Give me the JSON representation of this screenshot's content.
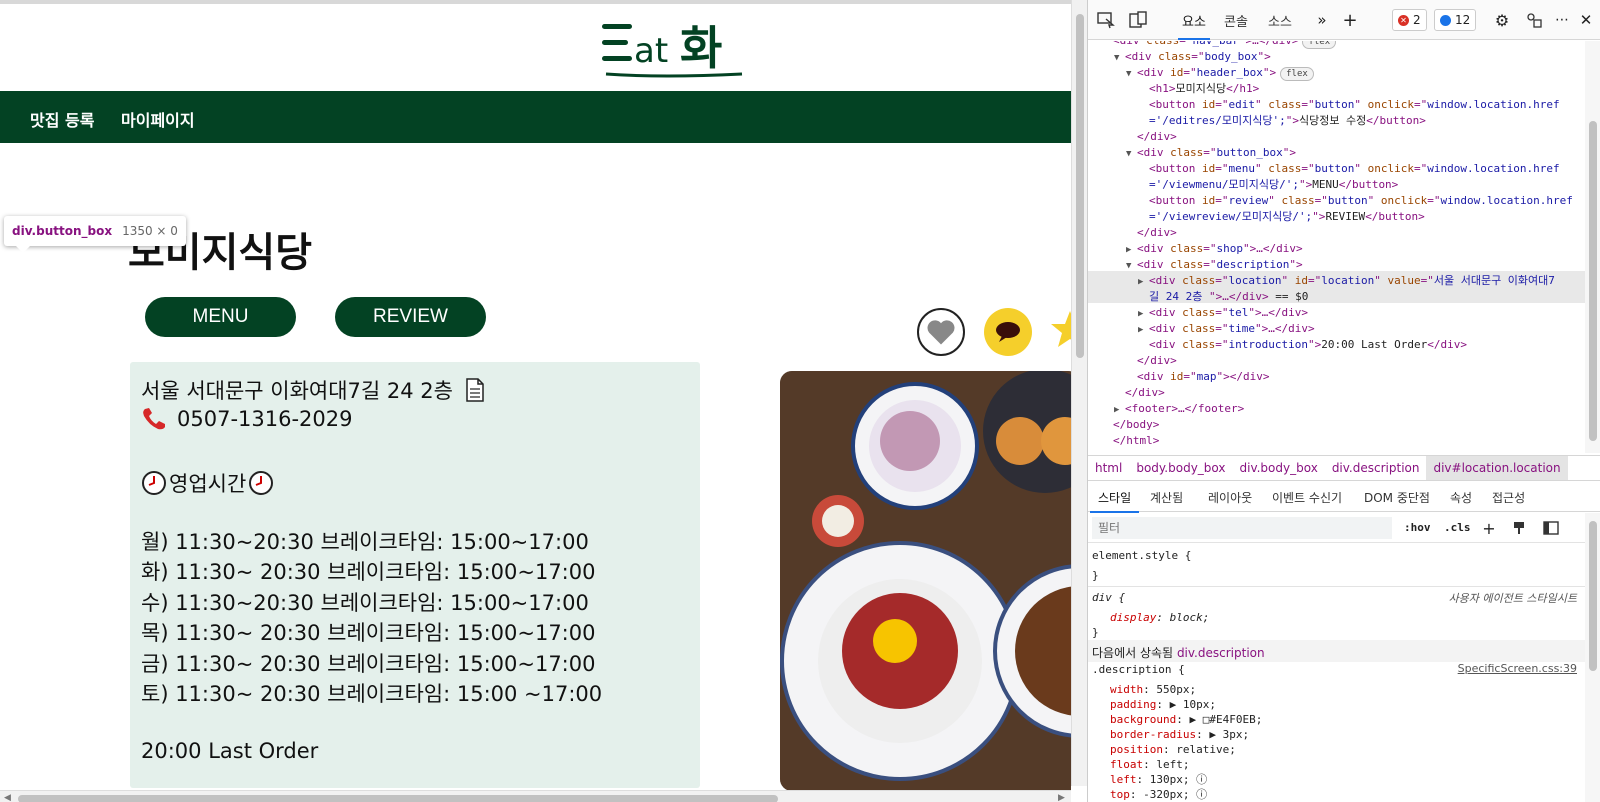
{
  "page": {
    "logo_text": "Eat화",
    "nav": [
      "맛집 등록",
      "마이페이지"
    ],
    "tooltip": {
      "tag": "div.button_box",
      "size": "1350 × 0"
    },
    "shop_title": "모미지식당",
    "buttons": {
      "menu": "MENU",
      "review": "REVIEW"
    },
    "description": {
      "location": "서울 서대문구 이화여대7길 24 2층",
      "tel": "0507-1316-2029",
      "hours_title": "영업시간",
      "hours": [
        "월) 11:30~20:30 브레이크타임: 15:00~17:00",
        "화) 11:30~ 20:30 브레이크타임: 15:00~17:00",
        "수) 11:30~20:30 브레이크타임: 15:00~17:00",
        "목) 11:30~ 20:30 브레이크타임: 15:00~17:00",
        "금) 11:30~ 20:30 브레이크타임: 15:00~17:00",
        "토) 11:30~ 20:30 브레이크타임: 15:00 ~17:00"
      ],
      "last_order": "20:00 Last Order"
    },
    "colors": {
      "brand_green": "#034223",
      "desc_bg": "#E4F0EB",
      "chat_yellow": "#f5cf2b"
    }
  },
  "devtools": {
    "tabs": [
      "요소",
      "콘솔",
      "소스"
    ],
    "errors": "2",
    "infos": "12",
    "dom": [
      {
        "indent": 0,
        "tri": "",
        "html": [
          [
            "tag",
            "<div "
          ],
          [
            "attr",
            "class"
          ],
          [
            "tag",
            "=\""
          ],
          [
            "val",
            "nav_bar"
          ],
          [
            "tag",
            "\">…</div>"
          ]
        ],
        "pill": "flex"
      },
      {
        "indent": 1,
        "tri": "▼",
        "html": [
          [
            "tag",
            "<div "
          ],
          [
            "attr",
            "class"
          ],
          [
            "tag",
            "=\""
          ],
          [
            "val",
            "body_box"
          ],
          [
            "tag",
            "\">"
          ]
        ]
      },
      {
        "indent": 2,
        "tri": "▼",
        "html": [
          [
            "tag",
            "<div "
          ],
          [
            "attr",
            "id"
          ],
          [
            "tag",
            "=\""
          ],
          [
            "val",
            "header_box"
          ],
          [
            "tag",
            "\">"
          ]
        ],
        "pill": "flex"
      },
      {
        "indent": 3,
        "tri": "",
        "html": [
          [
            "tag",
            "<h1>"
          ],
          [
            "txt",
            "모미지식당"
          ],
          [
            "tag",
            "</h1>"
          ]
        ]
      },
      {
        "indent": 3,
        "tri": "",
        "html": [
          [
            "tag",
            "<button "
          ],
          [
            "attr",
            "id"
          ],
          [
            "tag",
            "=\""
          ],
          [
            "val",
            "edit"
          ],
          [
            "tag",
            "\" "
          ],
          [
            "attr",
            "class"
          ],
          [
            "tag",
            "=\""
          ],
          [
            "val",
            "button"
          ],
          [
            "tag",
            "\" "
          ],
          [
            "attr",
            "onclick"
          ],
          [
            "tag",
            "=\""
          ],
          [
            "val",
            "window.location.href"
          ]
        ]
      },
      {
        "indent": 3,
        "tri": "",
        "html": [
          [
            "val",
            "='/editres/모미지식당';"
          ],
          [
            "tag",
            "\">"
          ],
          [
            "txt",
            "식당정보 수정"
          ],
          [
            "tag",
            "</button>"
          ]
        ]
      },
      {
        "indent": 2,
        "tri": "",
        "html": [
          [
            "tag",
            "</div>"
          ]
        ]
      },
      {
        "indent": 2,
        "tri": "▼",
        "html": [
          [
            "tag",
            "<div "
          ],
          [
            "attr",
            "class"
          ],
          [
            "tag",
            "=\""
          ],
          [
            "val",
            "button_box"
          ],
          [
            "tag",
            "\">"
          ]
        ]
      },
      {
        "indent": 3,
        "tri": "",
        "html": [
          [
            "tag",
            "<button "
          ],
          [
            "attr",
            "id"
          ],
          [
            "tag",
            "=\""
          ],
          [
            "val",
            "menu"
          ],
          [
            "tag",
            "\" "
          ],
          [
            "attr",
            "class"
          ],
          [
            "tag",
            "=\""
          ],
          [
            "val",
            "button"
          ],
          [
            "tag",
            "\" "
          ],
          [
            "attr",
            "onclick"
          ],
          [
            "tag",
            "=\""
          ],
          [
            "val",
            "window.location.href"
          ]
        ]
      },
      {
        "indent": 3,
        "tri": "",
        "html": [
          [
            "val",
            "='/viewmenu/모미지식당/';"
          ],
          [
            "tag",
            "\">"
          ],
          [
            "txt",
            "MENU"
          ],
          [
            "tag",
            "</button>"
          ]
        ]
      },
      {
        "indent": 3,
        "tri": "",
        "html": [
          [
            "tag",
            "<button "
          ],
          [
            "attr",
            "id"
          ],
          [
            "tag",
            "=\""
          ],
          [
            "val",
            "review"
          ],
          [
            "tag",
            "\" "
          ],
          [
            "attr",
            "class"
          ],
          [
            "tag",
            "=\""
          ],
          [
            "val",
            "button"
          ],
          [
            "tag",
            "\" "
          ],
          [
            "attr",
            "onclick"
          ],
          [
            "tag",
            "=\""
          ],
          [
            "val",
            "window.location.href"
          ]
        ]
      },
      {
        "indent": 3,
        "tri": "",
        "html": [
          [
            "val",
            "='/viewreview/모미지식당/';"
          ],
          [
            "tag",
            "\">"
          ],
          [
            "txt",
            "REVIEW"
          ],
          [
            "tag",
            "</button>"
          ]
        ]
      },
      {
        "indent": 2,
        "tri": "",
        "html": [
          [
            "tag",
            "</div>"
          ]
        ]
      },
      {
        "indent": 2,
        "tri": "▶",
        "html": [
          [
            "tag",
            "<div "
          ],
          [
            "attr",
            "class"
          ],
          [
            "tag",
            "=\""
          ],
          [
            "val",
            "shop"
          ],
          [
            "tag",
            "\">…</div>"
          ]
        ]
      },
      {
        "indent": 2,
        "tri": "▼",
        "html": [
          [
            "tag",
            "<div "
          ],
          [
            "attr",
            "class"
          ],
          [
            "tag",
            "=\""
          ],
          [
            "val",
            "description"
          ],
          [
            "tag",
            "\">"
          ]
        ]
      },
      {
        "indent": 3,
        "tri": "▶",
        "html": [
          [
            "tag",
            "<div "
          ],
          [
            "attr",
            "class"
          ],
          [
            "tag",
            "=\""
          ],
          [
            "val",
            "location"
          ],
          [
            "tag",
            "\" "
          ],
          [
            "attr",
            "id"
          ],
          [
            "tag",
            "=\""
          ],
          [
            "val",
            "location"
          ],
          [
            "tag",
            "\" "
          ],
          [
            "attr",
            "value"
          ],
          [
            "tag",
            "=\""
          ],
          [
            "val",
            "서울 서대문구 이화여대7"
          ]
        ]
      },
      {
        "indent": 3,
        "tri": "",
        "html": [
          [
            "val",
            "길 24 2층 "
          ],
          [
            "tag",
            "\">…</div>"
          ],
          [
            "txt",
            " == $0"
          ]
        ]
      },
      {
        "indent": 3,
        "tri": "▶",
        "html": [
          [
            "tag",
            "<div "
          ],
          [
            "attr",
            "class"
          ],
          [
            "tag",
            "=\""
          ],
          [
            "val",
            "tel"
          ],
          [
            "tag",
            "\">…</div>"
          ]
        ]
      },
      {
        "indent": 3,
        "tri": "▶",
        "html": [
          [
            "tag",
            "<div "
          ],
          [
            "attr",
            "class"
          ],
          [
            "tag",
            "=\""
          ],
          [
            "val",
            "time"
          ],
          [
            "tag",
            "\">…</div>"
          ]
        ]
      },
      {
        "indent": 3,
        "tri": "",
        "html": [
          [
            "tag",
            "<div "
          ],
          [
            "attr",
            "class"
          ],
          [
            "tag",
            "=\""
          ],
          [
            "val",
            "introduction"
          ],
          [
            "tag",
            "\">"
          ],
          [
            "txt",
            "20:00 Last Order"
          ],
          [
            "tag",
            "</div>"
          ]
        ]
      },
      {
        "indent": 2,
        "tri": "",
        "html": [
          [
            "tag",
            "</div>"
          ]
        ]
      },
      {
        "indent": 2,
        "tri": "",
        "html": [
          [
            "tag",
            "<div "
          ],
          [
            "attr",
            "id"
          ],
          [
            "tag",
            "=\""
          ],
          [
            "val",
            "map"
          ],
          [
            "tag",
            "\"></div>"
          ]
        ]
      },
      {
        "indent": 1,
        "tri": "",
        "html": [
          [
            "tag",
            "</div>"
          ]
        ]
      },
      {
        "indent": 1,
        "tri": "▶",
        "html": [
          [
            "tag",
            "<footer>…</footer>"
          ]
        ]
      },
      {
        "indent": 0,
        "tri": "",
        "html": [
          [
            "tag",
            "</body>"
          ]
        ]
      },
      {
        "indent": 0,
        "tri": "",
        "html": [
          [
            "tag",
            "</html>"
          ]
        ]
      }
    ],
    "breadcrumbs": [
      "html",
      "body.body_box",
      "div.body_box",
      "div.description",
      "div#location.location"
    ],
    "subtabs": [
      "스타일",
      "계산됨",
      "레이아웃",
      "이벤트 수신기",
      "DOM 중단점",
      "속성",
      "접근성"
    ],
    "filter_placeholder": "필터",
    "hov": ":hov",
    "cls": ".cls",
    "styles": {
      "element_style": "element.style {",
      "close": "}",
      "ua_selector": "div {",
      "ua_label": "사용자 에이전트 스타일시트",
      "ua_prop": "display",
      "ua_val": "block;",
      "inherited_label": "다음에서 상속됨",
      "inherited_from": "div.description",
      "rule_selector": ".description {",
      "rule_source": "SpecificScreen.css:39",
      "props": [
        [
          "width",
          "550px;"
        ],
        [
          "padding",
          "▶ 10px;"
        ],
        [
          "background",
          "▶ □#E4F0EB;"
        ],
        [
          "border-radius",
          "▶ 3px;"
        ],
        [
          "position",
          "relative;"
        ],
        [
          "float",
          "left;"
        ],
        [
          "left",
          "130px; ⓘ"
        ],
        [
          "top",
          "-320px; ⓘ"
        ]
      ]
    }
  }
}
